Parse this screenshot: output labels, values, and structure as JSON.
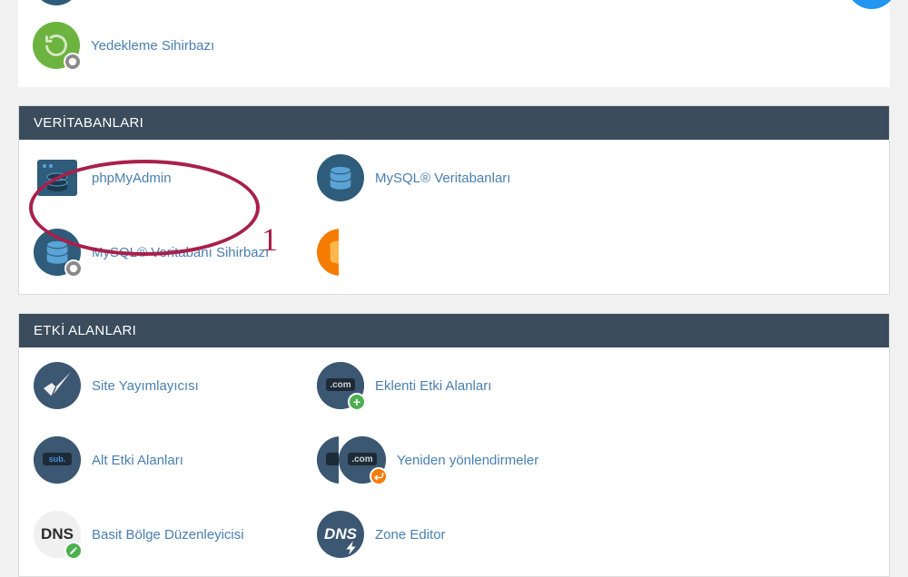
{
  "topSection": {
    "items": [
      {
        "label": "Yedekleme Sihirbazı"
      }
    ]
  },
  "panels": [
    {
      "header": "VERİTABANLARI",
      "items": [
        {
          "label": "phpMyAdmin",
          "icon": "phpmyadmin"
        },
        {
          "label": "MySQL® Veritabanları",
          "icon": "mysql"
        },
        {
          "label": "MySQL® Veritabanı Sihirbazı",
          "icon": "mysql-wizard"
        }
      ]
    },
    {
      "header": "ETKİ ALANLARI",
      "items": [
        {
          "label": "Site Yayımlayıcısı",
          "icon": "site-publisher"
        },
        {
          "label": "Eklenti Etki Alanları",
          "icon": "addon-domains"
        },
        {
          "label": "Alt Etki Alanları",
          "icon": "subdomains"
        },
        {
          "label": "Yeniden yönlendirmeler",
          "icon": "redirects"
        },
        {
          "label": "Basit Bölge Düzenleyicisi",
          "icon": "simple-zone"
        },
        {
          "label": "Zone Editor",
          "icon": "zone-editor"
        }
      ]
    }
  ],
  "annotation": {
    "number": "1"
  }
}
